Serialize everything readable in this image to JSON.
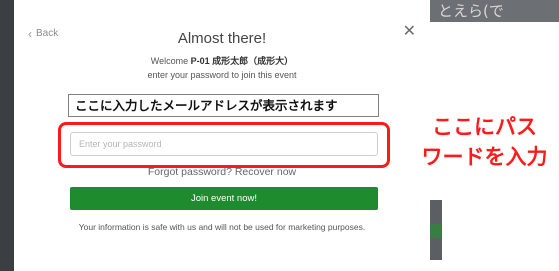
{
  "background": {
    "top_right_fragment": "とえら(で"
  },
  "modal": {
    "back_label": "Back",
    "back_icon": "chevron-left",
    "close_symbol": "✕",
    "title": "Almost there!",
    "welcome_prefix": "Welcome",
    "welcome_name": "P-01 成形太郎（成形大）",
    "subtitle": "enter your password to join this event",
    "email_display": "ここに入力したメールアドレスが表示されます",
    "password_placeholder": "Enter your password",
    "forgot_text": "Forgot password? Recover now",
    "join_button": "Join event now!",
    "privacy_note": "Your information is safe with us and will not be used for marketing purposes."
  },
  "annotation": {
    "line1": "ここにパス",
    "line2": "ワードを入力",
    "color": "#ff1a1a"
  },
  "colors": {
    "join_button_bg": "#1e8b2e",
    "highlight": "#ff1a1a"
  }
}
